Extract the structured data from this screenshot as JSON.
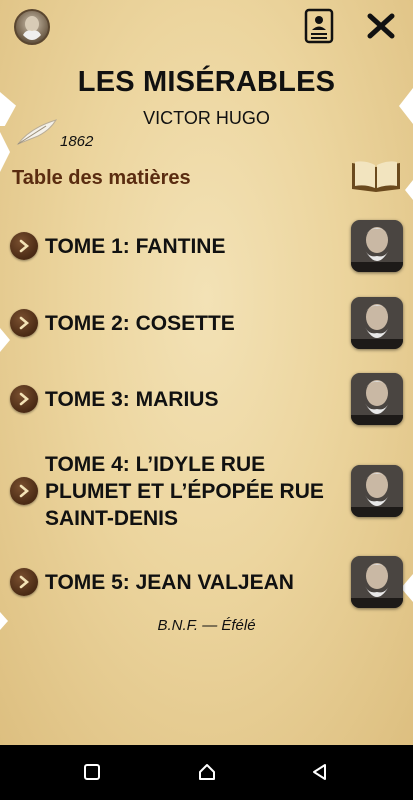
{
  "app": {
    "title": "LES MISÉRABLES",
    "author": "VICTOR HUGO",
    "year": "1862",
    "toc_heading": "Table des matières",
    "credit": "B.N.F. — Éfélé"
  },
  "toolbar": {
    "avatar_icon": "author-avatar-icon",
    "profile_icon": "profile-card-icon",
    "close_icon": "close-icon"
  },
  "tomes": [
    {
      "label": "TOME 1: FANTINE"
    },
    {
      "label": "TOME 2: COSETTE"
    },
    {
      "label": "TOME 3: MARIUS"
    },
    {
      "label": "TOME 4: L’IDYLE RUE PLUMET ET L’ÉPOPÉE RUE SAINT-DENIS"
    },
    {
      "label": "TOME 5: JEAN VALJEAN"
    }
  ],
  "navbar": {
    "recent_icon": "square-icon",
    "home_icon": "circle-icon",
    "back_icon": "triangle-back-icon"
  },
  "colors": {
    "parchment": "#ecd59e",
    "heading_brown": "#5a2c10",
    "arrow_brown": "#4a2a14"
  }
}
